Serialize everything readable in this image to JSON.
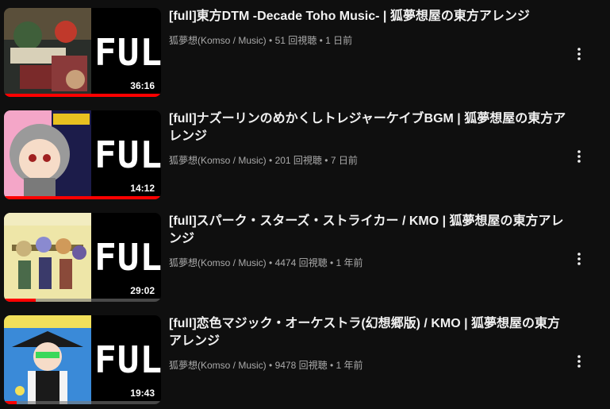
{
  "videos": [
    {
      "title": "[full]東方DTM -Decade Toho Music- | 狐夢想屋の東方アレンジ",
      "channel": "狐夢想(Komso / Music)",
      "views": "51 回視聴",
      "age": "1 日前",
      "duration": "36:16",
      "overlay_text": "FULL",
      "watched_fraction": 1.0
    },
    {
      "title": "[full]ナズーリンのめかくしトレジャーケイブBGM | 狐夢想屋の東方アレンジ",
      "channel": "狐夢想(Komso / Music)",
      "views": "201 回視聴",
      "age": "7 日前",
      "duration": "14:12",
      "overlay_text": "FULL",
      "watched_fraction": 1.0
    },
    {
      "title": "[full]スパーク・スターズ・ストライカー / KMO | 狐夢想屋の東方アレンジ",
      "channel": "狐夢想(Komso / Music)",
      "views": "4474 回視聴",
      "age": "1 年前",
      "duration": "29:02",
      "overlay_text": "FULL",
      "watched_fraction": 0.2
    },
    {
      "title": "[full]恋色マジック・オーケストラ(幻想郷版) / KMO | 狐夢想屋の東方アレンジ",
      "channel": "狐夢想(Komso / Music)",
      "views": "9478 回視聴",
      "age": "1 年前",
      "duration": "19:43",
      "overlay_text": "FULL",
      "watched_fraction": 0.08
    }
  ],
  "menu_icon": "more-vertical-icon",
  "colors": {
    "background": "#0f0f0f",
    "progress": "#ff0000",
    "meta_text": "#aaaaaa"
  }
}
